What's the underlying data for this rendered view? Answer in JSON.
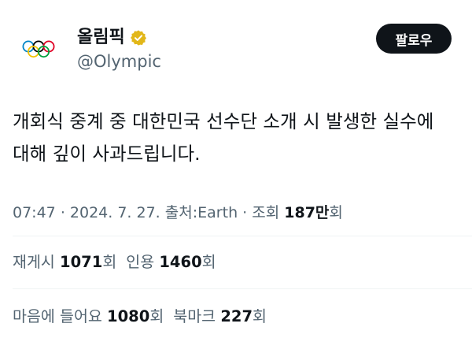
{
  "author": {
    "display_name": "올림픽",
    "handle": "@Olympic",
    "verified_badge": "gold-checkmark-icon",
    "badge_color": "#E2B719",
    "avatar_icon": "olympic-rings-icon"
  },
  "follow_button": {
    "label": "팔로우"
  },
  "tweet": {
    "text_lines": [
      "개회식 중계 중 대한민국 선수단 소개 시 발생한 실수에",
      "대해 깊이 사과드립니다."
    ]
  },
  "meta": {
    "time": "07:47",
    "separator": "·",
    "date": "2024. 7. 27.",
    "source_label": "출처:",
    "source": "Earth",
    "views_label": "조회",
    "views_count": "187만",
    "views_suffix": "회"
  },
  "stats_row_1": {
    "reposts_label": "재게시",
    "reposts_value": "1071",
    "reposts_suffix": "회",
    "quotes_label": "인용",
    "quotes_value": "1460",
    "quotes_suffix": "회"
  },
  "stats_row_2": {
    "likes_label": "마음에 들어요",
    "likes_value": "1080",
    "likes_suffix": "회",
    "bookmarks_label": "북마크",
    "bookmarks_value": "227",
    "bookmarks_suffix": "회"
  },
  "colors": {
    "text_primary": "#0F1419",
    "text_secondary": "#536471",
    "button_bg": "#0F1419",
    "divider": "#EFF3F4"
  }
}
